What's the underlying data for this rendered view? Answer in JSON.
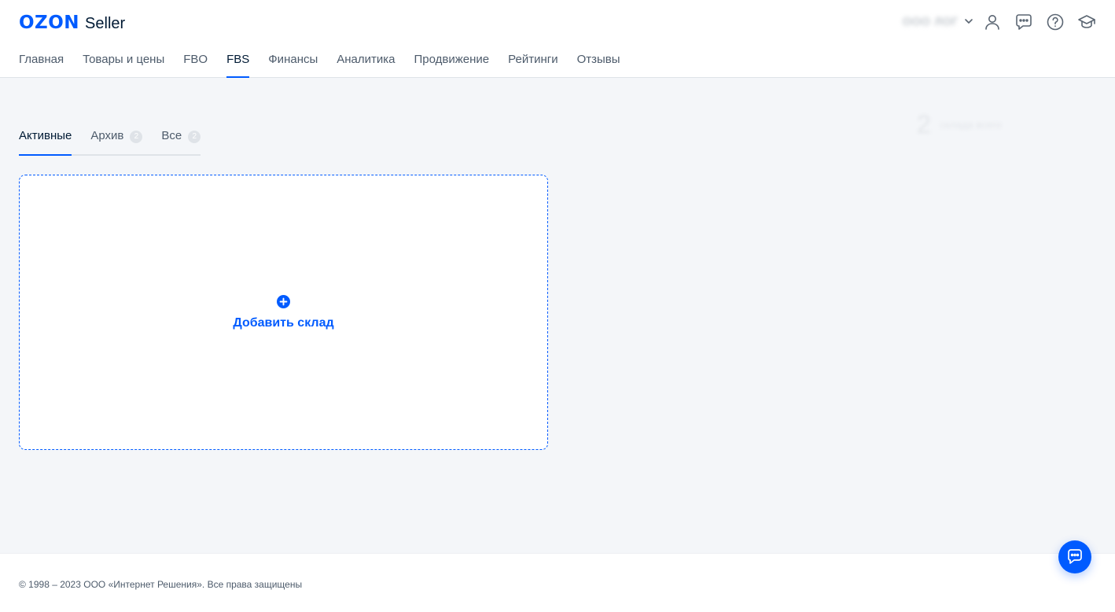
{
  "header": {
    "logo_brand": "OZON",
    "logo_product": "Seller",
    "account_name": "ООО ЛОГ"
  },
  "nav": {
    "items": [
      {
        "label": "Главная",
        "active": false
      },
      {
        "label": "Товары и цены",
        "active": false
      },
      {
        "label": "FBO",
        "active": false
      },
      {
        "label": "FBS",
        "active": true
      },
      {
        "label": "Финансы",
        "active": false
      },
      {
        "label": "Аналитика",
        "active": false
      },
      {
        "label": "Продвижение",
        "active": false
      },
      {
        "label": "Рейтинги",
        "active": false
      },
      {
        "label": "Отзывы",
        "active": false
      }
    ]
  },
  "tabs": {
    "items": [
      {
        "label": "Активные",
        "count": "",
        "active": true
      },
      {
        "label": "Архив",
        "count": "2",
        "active": false
      },
      {
        "label": "Все",
        "count": "2",
        "active": false
      }
    ]
  },
  "stat": {
    "number": "2",
    "label": "склада всего"
  },
  "main": {
    "add_warehouse_label": "Добавить склад"
  },
  "footer": {
    "copyright": "© 1998 – 2023 ООО «Интернет Решения». Все права защищены"
  },
  "colors": {
    "accent": "#005bff",
    "background": "#f4f6f9",
    "text": "#001a34"
  }
}
